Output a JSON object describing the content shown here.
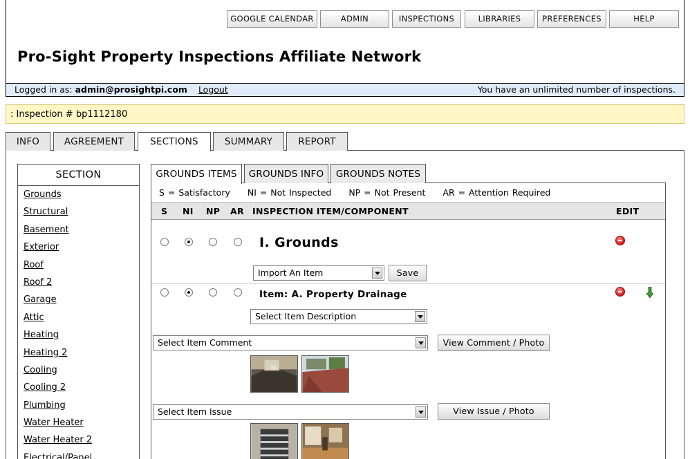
{
  "nav": [
    "GOOGLE CALENDAR",
    "ADMIN",
    "INSPECTIONS",
    "LIBRARIES",
    "PREFERENCES",
    "HELP"
  ],
  "site_title": "Pro-Sight Property Inspections Affiliate Network",
  "login": {
    "prefix": "Logged in as:",
    "user": "admin@prosightpi.com",
    "logout": "Logout",
    "quota": "You have an unlimited number of inspections."
  },
  "inspection_label": ": Inspection # bp1112180",
  "tabs": [
    "INFO",
    "AGREEMENT",
    "SECTIONS",
    "SUMMARY",
    "REPORT"
  ],
  "active_tab": "SECTIONS",
  "sidebar": {
    "heading": "SECTION",
    "items": [
      "Grounds",
      "Structural",
      "Basement",
      "Exterior",
      "Roof",
      "Roof 2",
      "Garage",
      "Attic",
      "Heating",
      "Heating 2",
      "Cooling",
      "Cooling 2",
      "Plumbing",
      "Water Heater",
      "Water Heater 2",
      "Electrical/Panel"
    ]
  },
  "subtabs": [
    "GROUNDS ITEMS",
    "GROUNDS INFO",
    "GROUNDS NOTES"
  ],
  "legend": [
    "S = Satisfactory",
    "NI = Not Inspected",
    "NP = Not Present",
    "AR = Attention Required"
  ],
  "columns": {
    "s": "S",
    "ni": "NI",
    "np": "NP",
    "ar": "AR",
    "item": "INSPECTION ITEM/COMPONENT",
    "edit": "EDIT"
  },
  "section": {
    "title": "I. Grounds",
    "rating": "NI",
    "import_select": "Import An Item",
    "save": "Save"
  },
  "item": {
    "title": "Item: A. Property Drainage",
    "rating": "NI",
    "description_select": "Select Item Description",
    "comment_select": "Select Item Comment",
    "comment_button": "View Comment / Photo",
    "issue_select": "Select Item Issue",
    "issue_button": "View Issue / Photo"
  },
  "colors": {
    "login_bar": "#e0ecf9",
    "inspection_bar": "#fff7c5",
    "delete": "#d21f1f",
    "arrow": "#3d9a2c"
  },
  "icons": {
    "delete": "delete-icon",
    "move_down": "arrow-down-icon"
  }
}
